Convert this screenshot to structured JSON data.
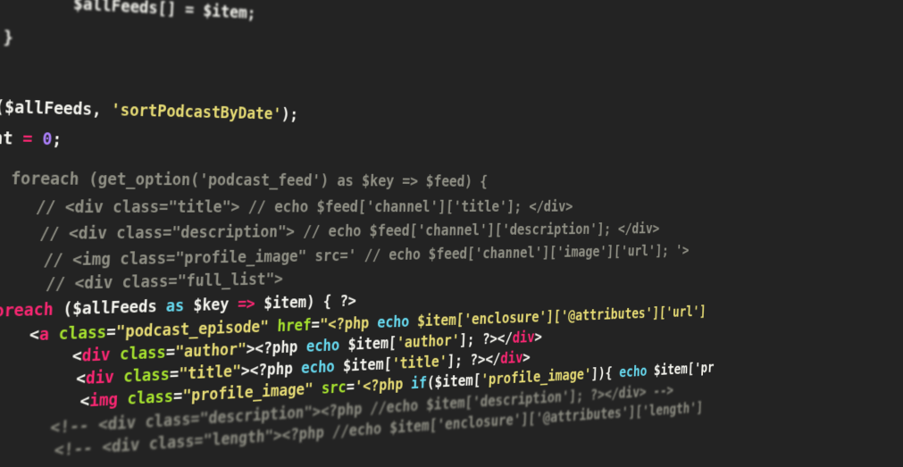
{
  "code_lines": [
    {
      "tokens": [
        {
          "t": "    $allFeeds[] = $item;",
          "c": "var"
        }
      ]
    },
    {
      "tokens": [
        {
          "t": "}",
          "c": "plain"
        }
      ]
    },
    {
      "tokens": [
        {
          "t": "",
          "c": "plain"
        }
      ]
    },
    {
      "tokens": [
        {
          "t": "(",
          "c": "plain"
        },
        {
          "t": "$allFeeds",
          "c": "var"
        },
        {
          "t": ", ",
          "c": "plain"
        },
        {
          "t": "'sortPodcastByDate'",
          "c": "str"
        },
        {
          "t": ");",
          "c": "plain"
        }
      ]
    },
    {
      "tokens": [
        {
          "t": "nt ",
          "c": "plain"
        },
        {
          "t": "=",
          "c": "op"
        },
        {
          "t": " ",
          "c": "plain"
        },
        {
          "t": "0",
          "c": "num"
        },
        {
          "t": ";",
          "c": "plain"
        }
      ]
    },
    {
      "tokens": [
        {
          "t": "",
          "c": "plain"
        }
      ]
    },
    {
      "tokens": [
        {
          "t": "  foreach (get_option('podcast_feed') as $key => $feed) {",
          "c": "com"
        }
      ]
    },
    {
      "tokens": [
        {
          "t": "    // <div class=\"title\"> // echo $feed['channel']['title']; </div>",
          "c": "com"
        }
      ]
    },
    {
      "tokens": [
        {
          "t": "    // <div class=\"description\"> // echo $feed['channel']['description']; </div>",
          "c": "com"
        }
      ]
    },
    {
      "tokens": [
        {
          "t": "    // <img class=\"profile_image\" src=' // echo $feed['channel']['image']['url']; '>",
          "c": "com"
        }
      ]
    },
    {
      "tokens": [
        {
          "t": "    // <div class=\"full_list\">",
          "c": "com"
        }
      ]
    },
    {
      "tokens": [
        {
          "t": "foreach",
          "c": "tag"
        },
        {
          "t": " (",
          "c": "plain"
        },
        {
          "t": "$allFeeds",
          "c": "var"
        },
        {
          "t": " as ",
          "c": "kw"
        },
        {
          "t": "$key ",
          "c": "var"
        },
        {
          "t": "=>",
          "c": "op"
        },
        {
          "t": " $item) { ?>",
          "c": "plain"
        }
      ]
    },
    {
      "tokens": [
        {
          "t": "    <",
          "c": "plain"
        },
        {
          "t": "a",
          "c": "tag"
        },
        {
          "t": " class",
          "c": "attr"
        },
        {
          "t": "=",
          "c": "plain"
        },
        {
          "t": "\"podcast_episode\"",
          "c": "str"
        },
        {
          "t": " href",
          "c": "attr"
        },
        {
          "t": "=",
          "c": "plain"
        },
        {
          "t": "\"<?php ",
          "c": "str"
        },
        {
          "t": "echo",
          "c": "kw"
        },
        {
          "t": " $item['enclosure']['@attributes']['url']",
          "c": "str"
        }
      ]
    },
    {
      "tokens": [
        {
          "t": "        <",
          "c": "plain"
        },
        {
          "t": "div",
          "c": "tag"
        },
        {
          "t": " class",
          "c": "attr"
        },
        {
          "t": "=",
          "c": "plain"
        },
        {
          "t": "\"author\"",
          "c": "str"
        },
        {
          "t": "><?php ",
          "c": "plain"
        },
        {
          "t": "echo",
          "c": "kw"
        },
        {
          "t": " $item[",
          "c": "plain"
        },
        {
          "t": "'author'",
          "c": "str"
        },
        {
          "t": "]; ?></",
          "c": "plain"
        },
        {
          "t": "div",
          "c": "tag"
        },
        {
          "t": ">",
          "c": "plain"
        }
      ]
    },
    {
      "tokens": [
        {
          "t": "        <",
          "c": "plain"
        },
        {
          "t": "div",
          "c": "tag"
        },
        {
          "t": " class",
          "c": "attr"
        },
        {
          "t": "=",
          "c": "plain"
        },
        {
          "t": "\"title\"",
          "c": "str"
        },
        {
          "t": "><?php ",
          "c": "plain"
        },
        {
          "t": "echo",
          "c": "kw"
        },
        {
          "t": " $item[",
          "c": "plain"
        },
        {
          "t": "'title'",
          "c": "str"
        },
        {
          "t": "]; ?></",
          "c": "plain"
        },
        {
          "t": "div",
          "c": "tag"
        },
        {
          "t": ">",
          "c": "plain"
        }
      ]
    },
    {
      "tokens": [
        {
          "t": "        <",
          "c": "plain"
        },
        {
          "t": "img",
          "c": "tag"
        },
        {
          "t": " class",
          "c": "attr"
        },
        {
          "t": "=",
          "c": "plain"
        },
        {
          "t": "\"profile_image\"",
          "c": "str"
        },
        {
          "t": " src",
          "c": "attr"
        },
        {
          "t": "=",
          "c": "plain"
        },
        {
          "t": "'<?php ",
          "c": "str"
        },
        {
          "t": "if",
          "c": "kw"
        },
        {
          "t": "($item[",
          "c": "plain"
        },
        {
          "t": "'profile_image'",
          "c": "str"
        },
        {
          "t": "]){ ",
          "c": "plain"
        },
        {
          "t": "echo",
          "c": "kw"
        },
        {
          "t": " $item['pr",
          "c": "plain"
        }
      ]
    },
    {
      "tokens": [
        {
          "t": "    <!-- <div class=\"description\"><?php //echo $item['description']; ?></div> -->",
          "c": "com"
        }
      ]
    },
    {
      "tokens": [
        {
          "t": "    <!-- <div class=\"length\"><?php //echo $item['enclosure']['@attributes']['length']",
          "c": "com"
        }
      ]
    }
  ],
  "colors": {
    "background": "#232323",
    "var": "#f4f4ee",
    "keyword": "#66d9ef",
    "tag": "#f92672",
    "attribute": "#a6e22e",
    "string": "#e6db74",
    "number": "#ae81ff",
    "comment": "#8f8f84"
  }
}
